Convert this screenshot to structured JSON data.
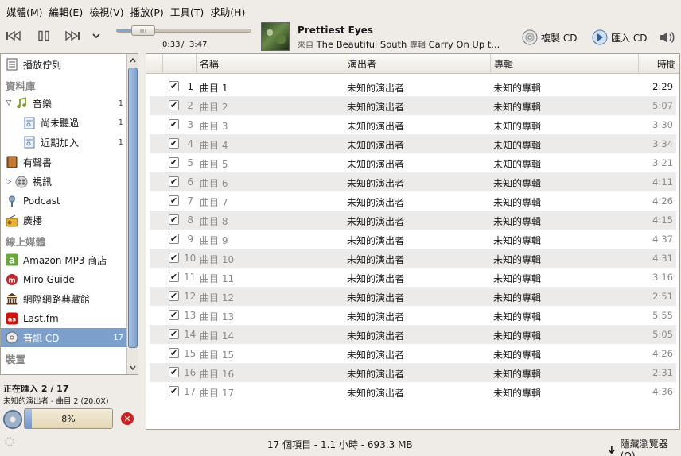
{
  "menubar": [
    "媒體(M)",
    "編輯(E)",
    "檢視(V)",
    "播放(P)",
    "工具(T)",
    "求助(H)"
  ],
  "player": {
    "position_text": "0:33",
    "length_sep": "/",
    "length_text": "3:47",
    "progress_fraction": 0.145
  },
  "now_playing": {
    "title": "Prettiest Eyes",
    "from_label": "來自",
    "album": "The Beautiful South",
    "by_label": "專輯",
    "artist": "Carry On Up t..."
  },
  "actions": {
    "copy_cd": "複製 CD",
    "import_cd": "匯入 CD"
  },
  "sidebar": {
    "items": [
      {
        "type": "item",
        "label": "播放佇列",
        "icon": "playlist-icon",
        "indent": 0,
        "count": ""
      },
      {
        "type": "header",
        "label": "資料庫"
      },
      {
        "type": "item",
        "label": "音樂",
        "icon": "music-note-icon",
        "indent": 1,
        "count": "1",
        "expander": "expanded"
      },
      {
        "type": "item",
        "label": "尚未聽過",
        "icon": "smart-playlist-icon",
        "indent": 2,
        "count": "1"
      },
      {
        "type": "item",
        "label": "近期加入",
        "icon": "smart-playlist-icon",
        "indent": 2,
        "count": "1"
      },
      {
        "type": "item",
        "label": "有聲書",
        "icon": "audiobook-icon",
        "indent": 0,
        "count": ""
      },
      {
        "type": "item",
        "label": "視訊",
        "icon": "video-icon",
        "indent": 1,
        "count": "",
        "expander": "collapsed"
      },
      {
        "type": "item",
        "label": "Podcast",
        "icon": "podcast-icon",
        "indent": 0,
        "count": ""
      },
      {
        "type": "item",
        "label": "廣播",
        "icon": "radio-icon",
        "indent": 0,
        "count": ""
      },
      {
        "type": "header",
        "label": "線上媒體"
      },
      {
        "type": "item",
        "label": "Amazon MP3 商店",
        "icon": "amazon-icon",
        "indent": 0,
        "count": ""
      },
      {
        "type": "item",
        "label": "Miro Guide",
        "icon": "miro-icon",
        "indent": 0,
        "count": ""
      },
      {
        "type": "item",
        "label": "網際網路典藏館",
        "icon": "archive-icon",
        "indent": 0,
        "count": ""
      },
      {
        "type": "item",
        "label": "Last.fm",
        "icon": "lastfm-icon",
        "indent": 0,
        "count": ""
      },
      {
        "type": "item",
        "label": "音訊 CD",
        "icon": "cd-icon",
        "indent": 0,
        "count": "17",
        "selected": true
      },
      {
        "type": "header",
        "label": "裝置"
      }
    ]
  },
  "import": {
    "status": "正在匯入 2 / 17",
    "track": "未知的演出者 - 曲目 2 (20.0X)",
    "percent_text": "8%",
    "progress_fraction": 0.08
  },
  "table": {
    "headers": {
      "name": "名稱",
      "artist": "演出者",
      "album": "專輯",
      "time": "時間"
    },
    "rows": [
      {
        "num": "1",
        "name": "曲目 1",
        "artist": "未知的演出者",
        "album": "未知的專輯",
        "time": "2:29",
        "active": true
      },
      {
        "num": "2",
        "name": "曲目 2",
        "artist": "未知的演出者",
        "album": "未知的專輯",
        "time": "5:07"
      },
      {
        "num": "3",
        "name": "曲目 3",
        "artist": "未知的演出者",
        "album": "未知的專輯",
        "time": "3:30"
      },
      {
        "num": "4",
        "name": "曲目 4",
        "artist": "未知的演出者",
        "album": "未知的專輯",
        "time": "3:34"
      },
      {
        "num": "5",
        "name": "曲目 5",
        "artist": "未知的演出者",
        "album": "未知的專輯",
        "time": "3:21"
      },
      {
        "num": "6",
        "name": "曲目 6",
        "artist": "未知的演出者",
        "album": "未知的專輯",
        "time": "4:11"
      },
      {
        "num": "7",
        "name": "曲目 7",
        "artist": "未知的演出者",
        "album": "未知的專輯",
        "time": "4:26"
      },
      {
        "num": "8",
        "name": "曲目 8",
        "artist": "未知的演出者",
        "album": "未知的專輯",
        "time": "4:15"
      },
      {
        "num": "9",
        "name": "曲目 9",
        "artist": "未知的演出者",
        "album": "未知的專輯",
        "time": "4:37"
      },
      {
        "num": "10",
        "name": "曲目 10",
        "artist": "未知的演出者",
        "album": "未知的專輯",
        "time": "4:31"
      },
      {
        "num": "11",
        "name": "曲目 11",
        "artist": "未知的演出者",
        "album": "未知的專輯",
        "time": "3:16"
      },
      {
        "num": "12",
        "name": "曲目 12",
        "artist": "未知的演出者",
        "album": "未知的專輯",
        "time": "2:51"
      },
      {
        "num": "13",
        "name": "曲目 13",
        "artist": "未知的演出者",
        "album": "未知的專輯",
        "time": "5:55"
      },
      {
        "num": "14",
        "name": "曲目 14",
        "artist": "未知的演出者",
        "album": "未知的專輯",
        "time": "5:05"
      },
      {
        "num": "15",
        "name": "曲目 15",
        "artist": "未知的演出者",
        "album": "未知的專輯",
        "time": "4:26"
      },
      {
        "num": "16",
        "name": "曲目 16",
        "artist": "未知的演出者",
        "album": "未知的專輯",
        "time": "2:31"
      },
      {
        "num": "17",
        "name": "曲目 17",
        "artist": "未知的演出者",
        "album": "未知的專輯",
        "time": "4:36"
      }
    ]
  },
  "statusbar": {
    "summary": "17 個項目 - 1.1 小時 - 693.3 MB",
    "hide_browser": "隱藏瀏覽器(O)"
  },
  "colors": {
    "selection": "#7d9fcb",
    "alt_row": "#ecebea",
    "cancel": "#d21f1f"
  }
}
